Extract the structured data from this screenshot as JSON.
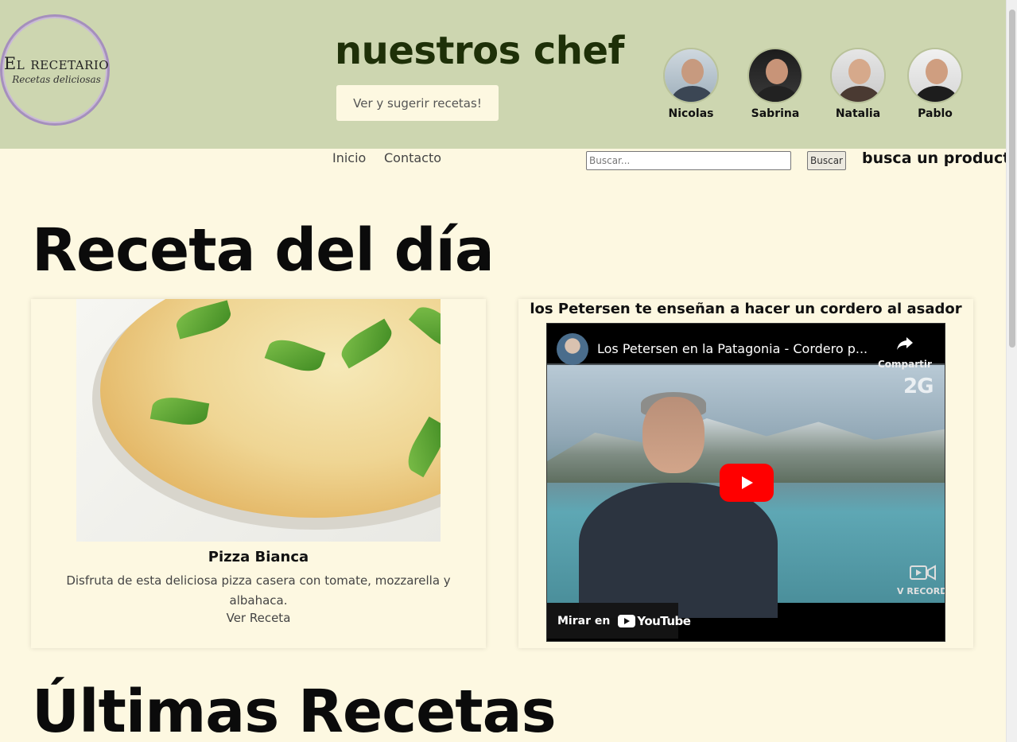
{
  "header": {
    "logo_title": "El recetario",
    "logo_subtitle": "Recetas deliciosas",
    "chefs_title": "nuestros chef",
    "suggest_button": "Ver y sugerir recetas!",
    "chefs": [
      {
        "name": "Nicolas"
      },
      {
        "name": "Sabrina"
      },
      {
        "name": "Natalia"
      },
      {
        "name": "Pablo"
      }
    ]
  },
  "nav": {
    "links": [
      "Inicio",
      "Contacto"
    ],
    "search_placeholder": "Buscar...",
    "search_button": "Buscar",
    "search_label": "busca un producto"
  },
  "main": {
    "recipe_of_day_title": "Receta del día",
    "recipe": {
      "name": "Pizza Bianca",
      "description": "Disfruta de esta deliciosa pizza casera con tomate, mozzarella y albahaca.",
      "link": "Ver Receta"
    },
    "video": {
      "heading": "los Petersen te enseñan a hacer un cordero al asador",
      "title": "Los Petersen en la Patagonia - Cordero p...",
      "share_label": "Compartir",
      "channel_mark": "2G",
      "recorder_label": "V RECORDE",
      "watch_label": "Mirar en",
      "youtube_text": "YouTube"
    },
    "latest_title": "Últimas Recetas"
  },
  "colors": {
    "header_bg": "#cdd6b0",
    "page_bg": "#fdf8e1",
    "chef_title": "#1e3008",
    "logo_ring": "#a58fbd",
    "play_button": "#ff0000"
  }
}
